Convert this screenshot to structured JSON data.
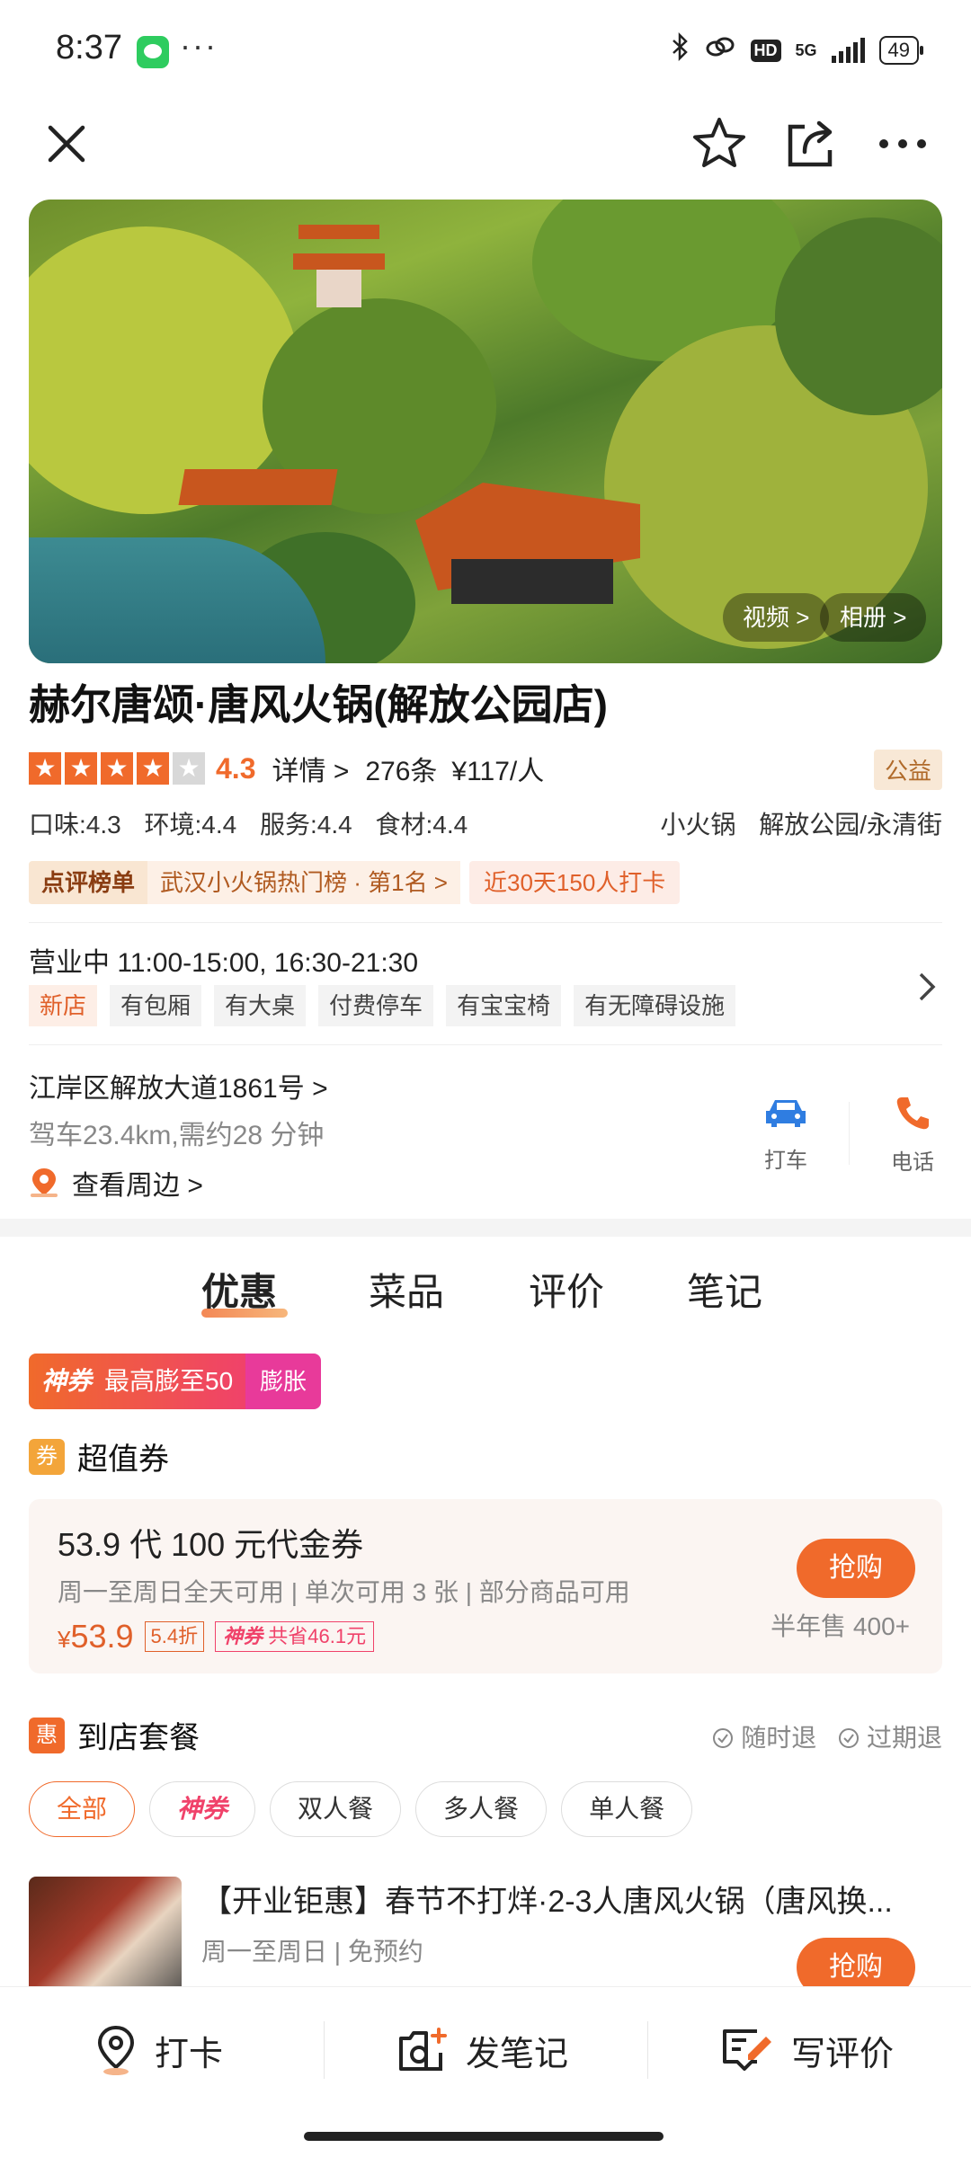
{
  "status_bar": {
    "time": "8:37",
    "dots": "···",
    "network": "5G",
    "hd": "HD",
    "battery": "49"
  },
  "hero": {
    "video_label": "视频 >",
    "album_label": "相册 >"
  },
  "shop": {
    "title": "赫尔唐颂·唐风火锅(解放公园店)",
    "rating": "4.3",
    "details_link": "详情 >",
    "review_count": "276条",
    "avg_price": "¥117/人",
    "charity_badge": "公益",
    "scores": [
      "口味:4.3",
      "环境:4.4",
      "服务:4.4",
      "食材:4.4"
    ],
    "category": "小火锅",
    "area": "解放公园/永清街",
    "rank_label": "点评榜单",
    "rank_text": "武汉小火锅热门榜 · 第1名 >",
    "checkin_text": "近30天150人打卡",
    "hours": "营业中  11:00-15:00, 16:30-21:30",
    "tags": [
      "新店",
      "有包厢",
      "有大桌",
      "付费停车",
      "有宝宝椅",
      "有无障碍设施"
    ],
    "address": "江岸区解放大道1861号 >",
    "drive": "驾车23.4km,需约28 分钟",
    "nearby": "查看周边 >",
    "taxi_label": "打车",
    "phone_label": "电话"
  },
  "tabs": [
    "优惠",
    "菜品",
    "评价",
    "笔记"
  ],
  "shenquan": {
    "brand": "神券",
    "text": "最高膨至50",
    "expand": "膨胀"
  },
  "voucher_section": {
    "icon": "券",
    "title": "超值券",
    "voucher_title": "53.9 代 100 元代金券",
    "desc": "周一至周日全天可用 | 单次可用 3 张 | 部分商品可用",
    "price_symbol": "¥",
    "price": "53.9",
    "discount": "5.4折",
    "save_brand": "神券",
    "save_text": "共省46.1元",
    "buy": "抢购",
    "sold": "半年售 400+"
  },
  "package_section": {
    "icon": "惠",
    "title": "到店套餐",
    "refund_any": "随时退",
    "refund_expired": "过期退",
    "filters": [
      "全部",
      "神券",
      "双人餐",
      "多人餐",
      "单人餐"
    ],
    "item_title": "【开业钜惠】春节不打烊·2-3人唐风火锅（唐风换...",
    "item_sub": "周一至周日 | 免预约",
    "item_buy": "抢购"
  },
  "bottom_bar": {
    "checkin": "打卡",
    "note": "发笔记",
    "review": "写评价"
  },
  "colors": {
    "accent": "#f06a2b",
    "pink": "#f0426a"
  }
}
